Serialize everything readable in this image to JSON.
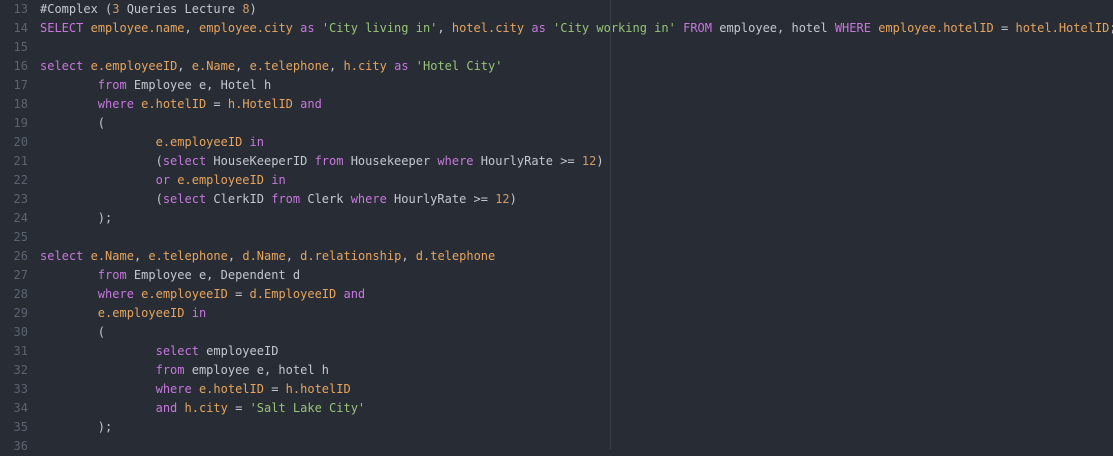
{
  "editor": {
    "lines": [
      {
        "num": "13",
        "tokens": [
          {
            "t": "#Complex (",
            "c": "plain"
          },
          {
            "t": "3",
            "c": "num"
          },
          {
            "t": " Queries Lecture ",
            "c": "plain"
          },
          {
            "t": "8",
            "c": "num"
          },
          {
            "t": ")",
            "c": "plain"
          }
        ]
      },
      {
        "num": "14",
        "tokens": [
          {
            "t": "SELECT",
            "c": "kw"
          },
          {
            "t": " ",
            "c": "plain"
          },
          {
            "t": "employee.name",
            "c": "id"
          },
          {
            "t": ", ",
            "c": "plain"
          },
          {
            "t": "employee.city",
            "c": "id"
          },
          {
            "t": " ",
            "c": "plain"
          },
          {
            "t": "as",
            "c": "kw"
          },
          {
            "t": " ",
            "c": "plain"
          },
          {
            "t": "'City living in'",
            "c": "str"
          },
          {
            "t": ", ",
            "c": "plain"
          },
          {
            "t": "hotel.city",
            "c": "id"
          },
          {
            "t": " ",
            "c": "plain"
          },
          {
            "t": "as",
            "c": "kw"
          },
          {
            "t": " ",
            "c": "plain"
          },
          {
            "t": "'City working in'",
            "c": "str"
          },
          {
            "t": " ",
            "c": "plain"
          },
          {
            "t": "FROM",
            "c": "kw"
          },
          {
            "t": " employee, hotel ",
            "c": "plain"
          },
          {
            "t": "WHERE",
            "c": "kw"
          },
          {
            "t": " ",
            "c": "plain"
          },
          {
            "t": "employee.hotelID",
            "c": "id"
          },
          {
            "t": " = ",
            "c": "plain"
          },
          {
            "t": "hotel.HotelID",
            "c": "id"
          },
          {
            "t": ";",
            "c": "plain"
          }
        ]
      },
      {
        "num": "15",
        "tokens": []
      },
      {
        "num": "16",
        "tokens": [
          {
            "t": "select",
            "c": "kw"
          },
          {
            "t": " ",
            "c": "plain"
          },
          {
            "t": "e.employeeID",
            "c": "id"
          },
          {
            "t": ", ",
            "c": "plain"
          },
          {
            "t": "e.Name",
            "c": "id"
          },
          {
            "t": ", ",
            "c": "plain"
          },
          {
            "t": "e.telephone",
            "c": "id"
          },
          {
            "t": ", ",
            "c": "plain"
          },
          {
            "t": "h.city",
            "c": "id"
          },
          {
            "t": " ",
            "c": "plain"
          },
          {
            "t": "as",
            "c": "kw"
          },
          {
            "t": " ",
            "c": "plain"
          },
          {
            "t": "'Hotel City'",
            "c": "str"
          }
        ]
      },
      {
        "num": "17",
        "tokens": [
          {
            "t": "        ",
            "c": "plain"
          },
          {
            "t": "from",
            "c": "kw"
          },
          {
            "t": " Employee e, Hotel h",
            "c": "plain"
          }
        ]
      },
      {
        "num": "18",
        "tokens": [
          {
            "t": "        ",
            "c": "plain"
          },
          {
            "t": "where",
            "c": "kw"
          },
          {
            "t": " ",
            "c": "plain"
          },
          {
            "t": "e.hotelID",
            "c": "id"
          },
          {
            "t": " = ",
            "c": "plain"
          },
          {
            "t": "h.HotelID",
            "c": "id"
          },
          {
            "t": " ",
            "c": "plain"
          },
          {
            "t": "and",
            "c": "kw"
          }
        ]
      },
      {
        "num": "19",
        "tokens": [
          {
            "t": "        (",
            "c": "plain"
          }
        ]
      },
      {
        "num": "20",
        "tokens": [
          {
            "t": "                ",
            "c": "plain"
          },
          {
            "t": "e.employeeID",
            "c": "id"
          },
          {
            "t": " ",
            "c": "plain"
          },
          {
            "t": "in",
            "c": "kw"
          }
        ]
      },
      {
        "num": "21",
        "tokens": [
          {
            "t": "                (",
            "c": "plain"
          },
          {
            "t": "select",
            "c": "kw"
          },
          {
            "t": " HouseKeeperID ",
            "c": "plain"
          },
          {
            "t": "from",
            "c": "kw"
          },
          {
            "t": " Housekeeper ",
            "c": "plain"
          },
          {
            "t": "where",
            "c": "kw"
          },
          {
            "t": " HourlyRate >= ",
            "c": "plain"
          },
          {
            "t": "12",
            "c": "num"
          },
          {
            "t": ")",
            "c": "plain"
          }
        ]
      },
      {
        "num": "22",
        "tokens": [
          {
            "t": "                ",
            "c": "plain"
          },
          {
            "t": "or",
            "c": "kw"
          },
          {
            "t": " ",
            "c": "plain"
          },
          {
            "t": "e.employeeID",
            "c": "id"
          },
          {
            "t": " ",
            "c": "plain"
          },
          {
            "t": "in",
            "c": "kw"
          }
        ]
      },
      {
        "num": "23",
        "tokens": [
          {
            "t": "                (",
            "c": "plain"
          },
          {
            "t": "select",
            "c": "kw"
          },
          {
            "t": " ClerkID ",
            "c": "plain"
          },
          {
            "t": "from",
            "c": "kw"
          },
          {
            "t": " Clerk ",
            "c": "plain"
          },
          {
            "t": "where",
            "c": "kw"
          },
          {
            "t": " HourlyRate >= ",
            "c": "plain"
          },
          {
            "t": "12",
            "c": "num"
          },
          {
            "t": ")",
            "c": "plain"
          }
        ]
      },
      {
        "num": "24",
        "tokens": [
          {
            "t": "        );",
            "c": "plain"
          }
        ]
      },
      {
        "num": "25",
        "tokens": []
      },
      {
        "num": "26",
        "tokens": [
          {
            "t": "select",
            "c": "kw"
          },
          {
            "t": " ",
            "c": "plain"
          },
          {
            "t": "e.Name",
            "c": "id"
          },
          {
            "t": ", ",
            "c": "plain"
          },
          {
            "t": "e.telephone",
            "c": "id"
          },
          {
            "t": ", ",
            "c": "plain"
          },
          {
            "t": "d.Name",
            "c": "id"
          },
          {
            "t": ", ",
            "c": "plain"
          },
          {
            "t": "d.relationship",
            "c": "id"
          },
          {
            "t": ", ",
            "c": "plain"
          },
          {
            "t": "d.telephone",
            "c": "id"
          }
        ]
      },
      {
        "num": "27",
        "tokens": [
          {
            "t": "        ",
            "c": "plain"
          },
          {
            "t": "from",
            "c": "kw"
          },
          {
            "t": " Employee e, Dependent d",
            "c": "plain"
          }
        ]
      },
      {
        "num": "28",
        "tokens": [
          {
            "t": "        ",
            "c": "plain"
          },
          {
            "t": "where",
            "c": "kw"
          },
          {
            "t": " ",
            "c": "plain"
          },
          {
            "t": "e.employeeID",
            "c": "id"
          },
          {
            "t": " = ",
            "c": "plain"
          },
          {
            "t": "d.EmployeeID",
            "c": "id"
          },
          {
            "t": " ",
            "c": "plain"
          },
          {
            "t": "and",
            "c": "kw"
          }
        ]
      },
      {
        "num": "29",
        "tokens": [
          {
            "t": "        ",
            "c": "plain"
          },
          {
            "t": "e.employeeID",
            "c": "id"
          },
          {
            "t": " ",
            "c": "plain"
          },
          {
            "t": "in",
            "c": "kw"
          }
        ]
      },
      {
        "num": "30",
        "tokens": [
          {
            "t": "        (",
            "c": "plain"
          }
        ]
      },
      {
        "num": "31",
        "tokens": [
          {
            "t": "                ",
            "c": "plain"
          },
          {
            "t": "select",
            "c": "kw"
          },
          {
            "t": " employeeID",
            "c": "plain"
          }
        ]
      },
      {
        "num": "32",
        "tokens": [
          {
            "t": "                ",
            "c": "plain"
          },
          {
            "t": "from",
            "c": "kw"
          },
          {
            "t": " employee e, hotel h",
            "c": "plain"
          }
        ]
      },
      {
        "num": "33",
        "tokens": [
          {
            "t": "                ",
            "c": "plain"
          },
          {
            "t": "where",
            "c": "kw"
          },
          {
            "t": " ",
            "c": "plain"
          },
          {
            "t": "e.hotelID",
            "c": "id"
          },
          {
            "t": " = ",
            "c": "plain"
          },
          {
            "t": "h.hotelID",
            "c": "id"
          }
        ]
      },
      {
        "num": "34",
        "tokens": [
          {
            "t": "                ",
            "c": "plain"
          },
          {
            "t": "and",
            "c": "kw"
          },
          {
            "t": " ",
            "c": "plain"
          },
          {
            "t": "h.city",
            "c": "id"
          },
          {
            "t": " = ",
            "c": "plain"
          },
          {
            "t": "'Salt Lake City'",
            "c": "str"
          }
        ]
      },
      {
        "num": "35",
        "tokens": [
          {
            "t": "        );",
            "c": "plain"
          }
        ]
      },
      {
        "num": "36",
        "tokens": []
      }
    ]
  },
  "colors": {
    "background": "#282c34",
    "keyword": "#c678dd",
    "identifier": "#e5a55f",
    "string": "#98c379",
    "number": "#d19a66",
    "plain": "#c3c8cf",
    "line_number": "#5c6370"
  }
}
